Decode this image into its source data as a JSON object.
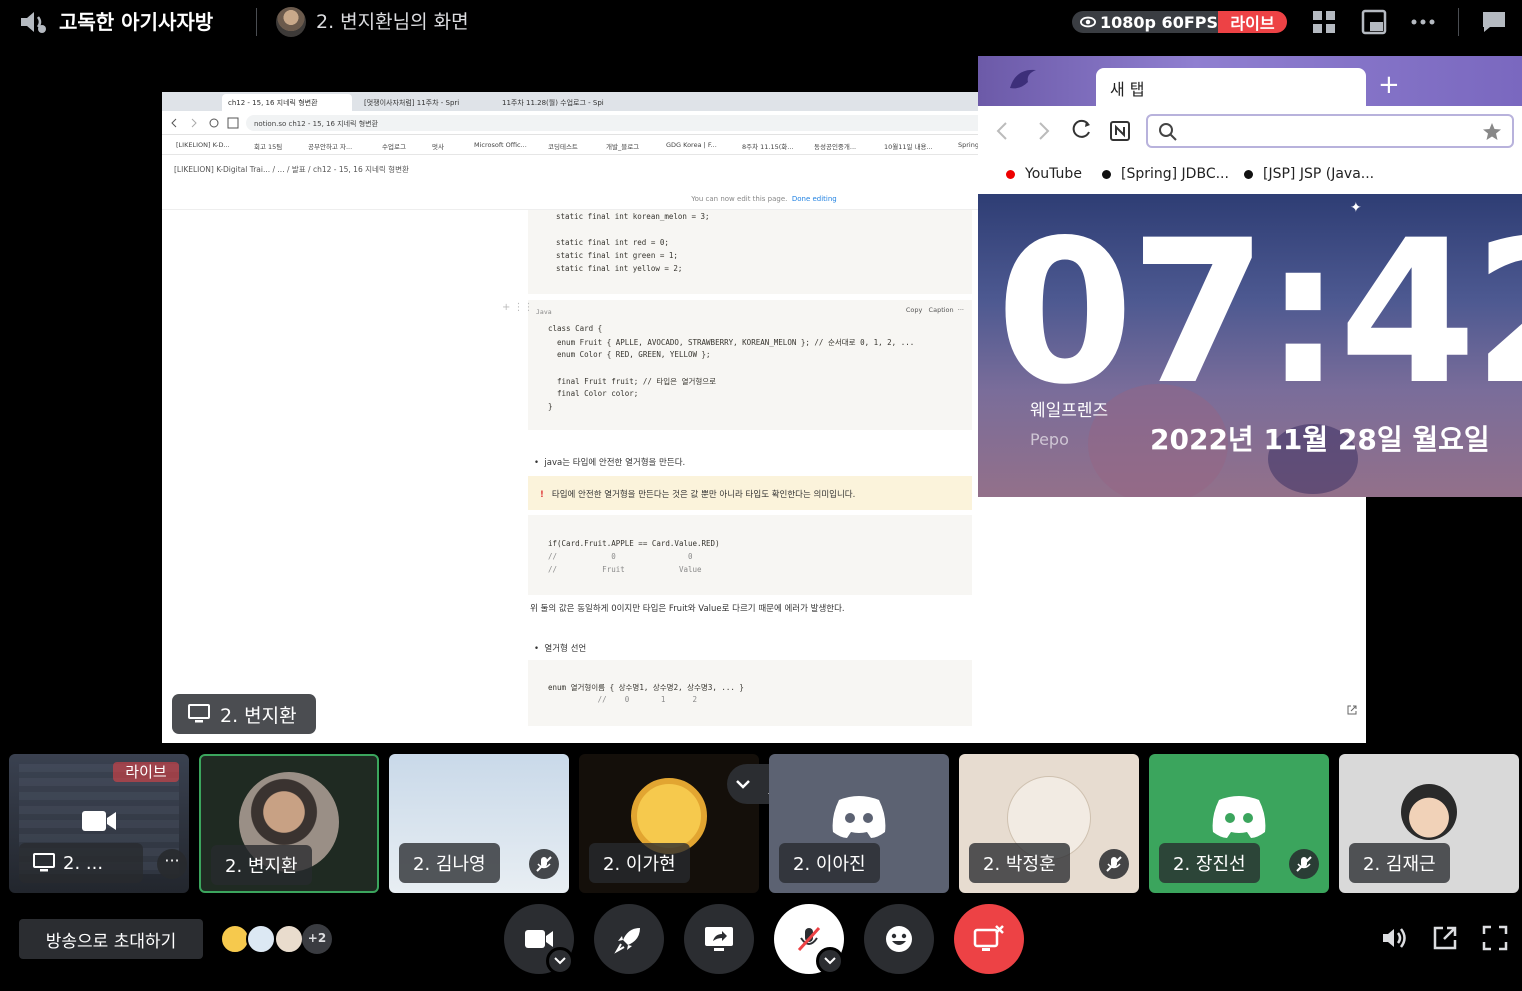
{
  "topbar": {
    "channel_name": "고독한 아기사자방",
    "screen_share_title": "2. 변지환님의 화면",
    "quality": "1080p 60FPS",
    "live_label": "라이브"
  },
  "shared_screen": {
    "chrome_tabs": [
      "ch12 - 15, 16 지네릭 형변환",
      "[멋쟁이사자처럼] 11주차 - Spri",
      "11주차 11.28(월) 수업로그 - Spi"
    ],
    "url": "notion.so ch12 - 15, 16 지네릭 형변환",
    "bookmarks": [
      "[LIKELION] K-D...",
      "회고 15팀",
      "공부안하고 자...",
      "수업로그",
      "멋사",
      "Microsoft Offic...",
      "코딩테스트",
      "개발_블로그",
      "GDG Korea | F...",
      "8주차 11.15(화...",
      "동성공인중개...",
      "10월11일 내용...",
      "Spring"
    ],
    "breadcrumb": "[LIKELION] K-Digital Trai...  /  ...  /  발표  /  ch12 - 15, 16 지네릭 형변환",
    "banner_text": "You can now edit this page.",
    "banner_action": "Done editing",
    "code_block_1": [
      "static final int korean_melon = 3;",
      "",
      "static final int red = 0;",
      "static final int green = 1;",
      "static final int yellow = 2;"
    ],
    "code_lang": "Java",
    "code_copy": "Copy",
    "code_caption": "Caption",
    "code_block_2": [
      "class Card {",
      "  enum Fruit { APLLE, AVOCADO, STRAWBERRY, KOREAN_MELON }; // 순서대로 0, 1, 2, ...",
      "  enum Color { RED, GREEN, YELLOW };",
      "",
      "  final Fruit fruit; // 타입은 열거형으로",
      "  final Color color;",
      "}"
    ],
    "bullet_1": "java는 타입에 안전한 열거형을 만든다.",
    "callout": "타입에 안전한 열거형을 만든다는 것은 값 뿐만 아니라 타입도 확인한다는 의미입니다.",
    "code_block_3": [
      "if(Card.Fruit.APPLE == Card.Value.RED)",
      "//            0                0",
      "//          Fruit            Value"
    ],
    "paragraph_1": "위 둘의 값은 동일하게 0이지만 타입은 Fruit와 Value로 다르기 때문에 에러가 발생한다.",
    "bullet_2": "열거형 선언",
    "code_block_4": [
      "enum 열거형이름 { 상수명1, 상수명2, 상수명3, ... }",
      "           //    0       1      2"
    ],
    "sharer_label": "2. 변지환"
  },
  "whale_popup": {
    "tab_title": "새 탭",
    "bookmarks": [
      "YouTube",
      "[Spring] JDBC...",
      "[JSP] JSP (Java..."
    ],
    "clock": "07:42",
    "date": "2022년 11월 28일 월요일",
    "brand": "웨일프렌즈",
    "character": "Pepo"
  },
  "participants": [
    {
      "name": "2. ...",
      "live": "라이브",
      "type": "stream"
    },
    {
      "name": "2. 변지환",
      "type": "video"
    },
    {
      "name": "2. 김나영",
      "muted": true
    },
    {
      "name": "2. 이가현"
    },
    {
      "name": "2. 이아진"
    },
    {
      "name": "2. 박정훈",
      "muted": true
    },
    {
      "name": "2. 장진선",
      "muted": true
    },
    {
      "name": "2. 김재근"
    }
  ],
  "bottombar": {
    "invite_label": "방송으로 초대하기",
    "viewer_extra": "+2"
  },
  "colors": {
    "live_red": "#ed4245",
    "discord_blurple": "#5865f2",
    "control_bg": "#2b2d31",
    "leave_red": "#ed4245",
    "green_tile": "#3ba55d",
    "speaking_green": "#3ba55d"
  },
  "icons": [
    "speaker-icon",
    "grid-icon",
    "popout-icon",
    "more-icon",
    "chat-icon",
    "camera-icon",
    "activity-rocket-icon",
    "screenshare-icon",
    "mic-muted-icon",
    "emoji-icon",
    "leave-stream-icon",
    "volume-icon",
    "external-icon",
    "fullscreen-icon"
  ]
}
